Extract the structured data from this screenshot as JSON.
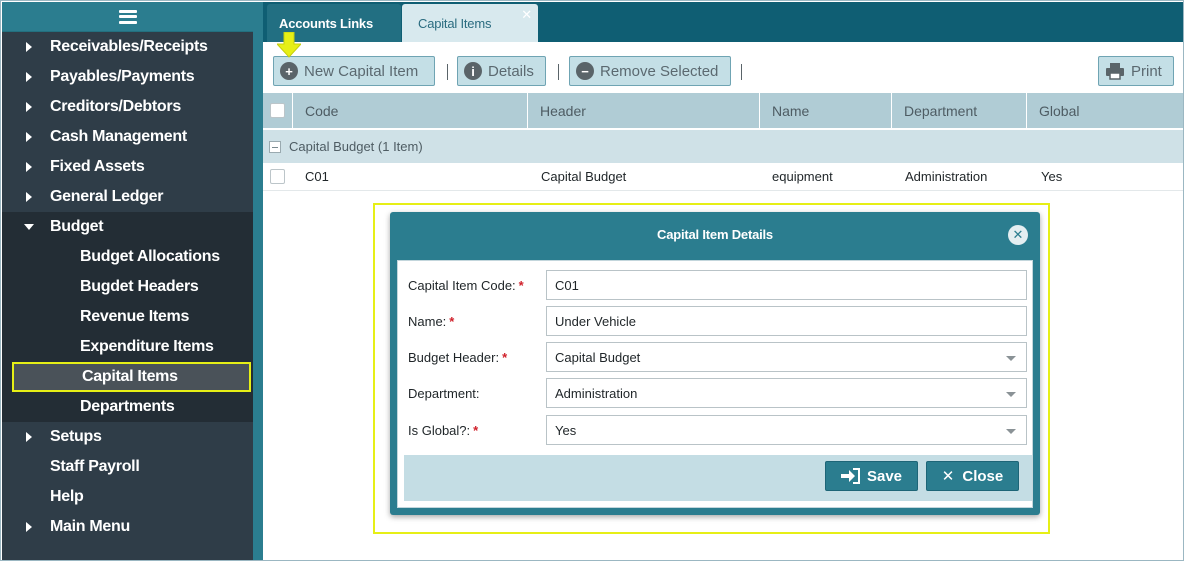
{
  "sidebar": {
    "menu": [
      {
        "label": "Receivables/Receipts"
      },
      {
        "label": "Payables/Payments"
      },
      {
        "label": "Creditors/Debtors"
      },
      {
        "label": "Cash Management"
      },
      {
        "label": "Fixed Assets"
      },
      {
        "label": "General Ledger"
      },
      {
        "label": "Budget"
      }
    ],
    "budget_sub": [
      {
        "label": "Budget Allocations"
      },
      {
        "label": "Bugdet Headers"
      },
      {
        "label": "Revenue Items"
      },
      {
        "label": "Expenditure Items"
      },
      {
        "label": "Capital Items"
      },
      {
        "label": "Departments"
      }
    ],
    "menu_after": [
      {
        "label": "Setups"
      },
      {
        "label": "Staff Payroll"
      },
      {
        "label": "Help"
      },
      {
        "label": "Main Menu"
      }
    ]
  },
  "tabs": [
    {
      "label": "Accounts Links"
    },
    {
      "label": "Capital Items"
    }
  ],
  "toolbar": {
    "new_label": "New Capital Item",
    "details_label": "Details",
    "remove_label": "Remove Selected",
    "print_label": "Print"
  },
  "grid": {
    "columns": [
      "Code",
      "Header",
      "Name",
      "Department",
      "Global"
    ],
    "group_label": "Capital Budget (1 Item)",
    "rows": [
      {
        "code": "C01",
        "header": "Capital Budget",
        "name": "equipment",
        "department": "Administration",
        "global": "Yes"
      }
    ]
  },
  "dialog": {
    "title": "Capital Item Details",
    "fields": [
      {
        "label": "Capital Item Code:",
        "required": "*",
        "value": "C01"
      },
      {
        "label": "Name:",
        "required": "*",
        "value": "Under Vehicle"
      },
      {
        "label": "Budget Header:",
        "required": "*",
        "value": "Capital Budget"
      },
      {
        "label": "Department:",
        "required": "",
        "value": "Administration"
      },
      {
        "label": "Is Global?:",
        "required": "*",
        "value": "Yes"
      }
    ],
    "save_label": "Save",
    "close_label": "Close"
  },
  "colors": {
    "sidebar_bg": "#2f3d48",
    "accent_teal": "#2b7d8f",
    "highlight_yellow": "#e6ef16",
    "required_red": "#d0202a"
  }
}
